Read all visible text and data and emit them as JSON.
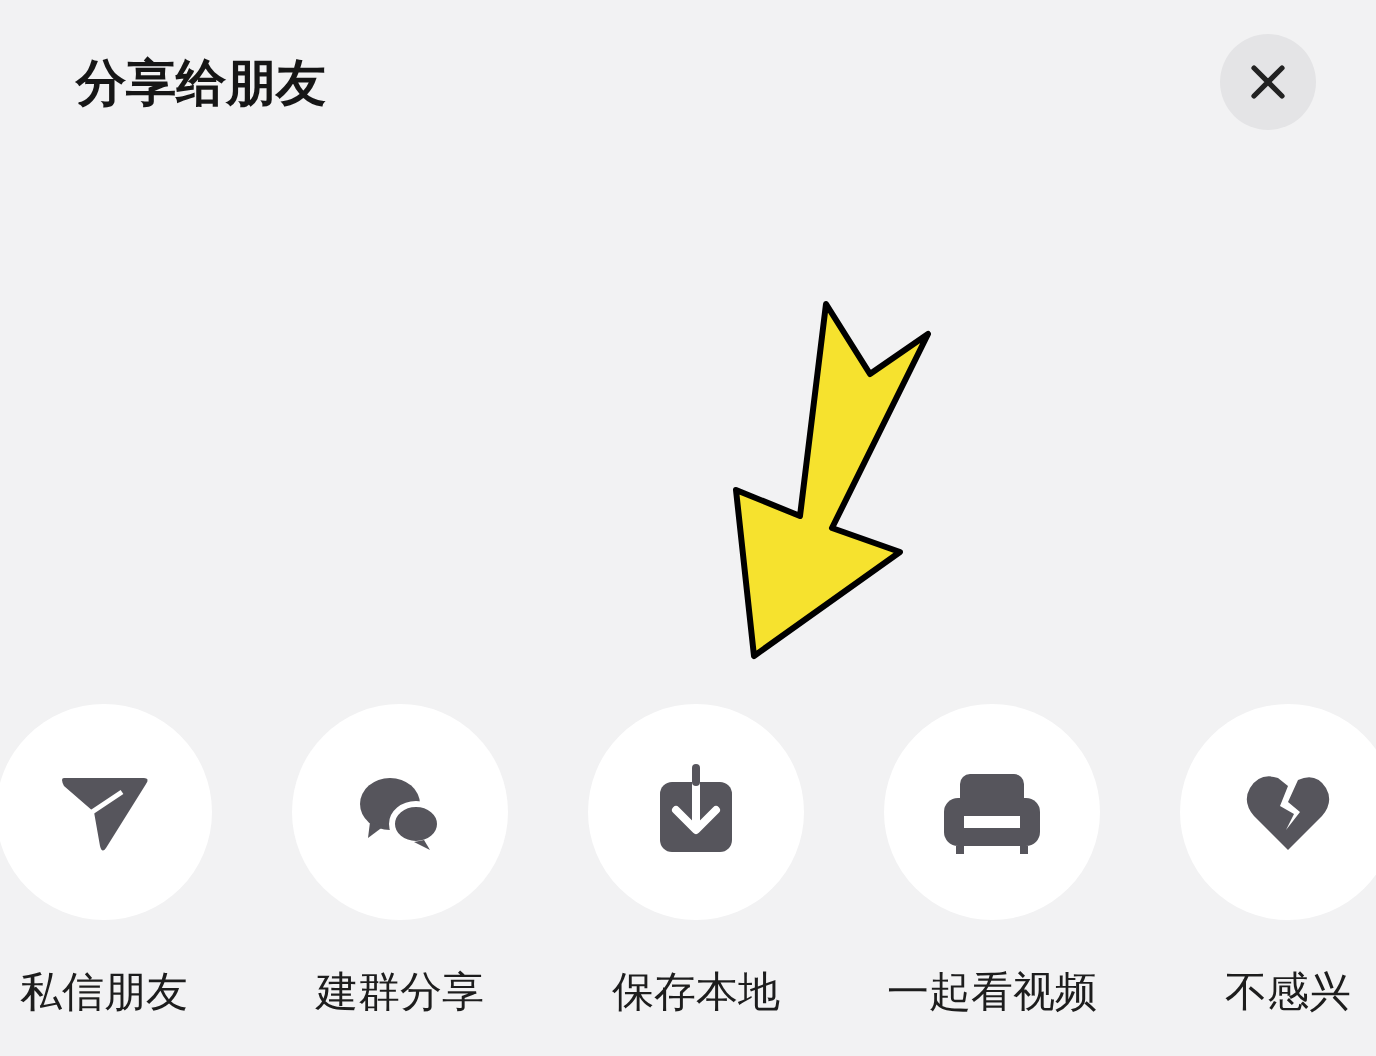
{
  "sheet": {
    "title": "分享给朋友"
  },
  "actions": [
    {
      "kind": "send",
      "label": "私信朋友"
    },
    {
      "kind": "group",
      "label": "建群分享"
    },
    {
      "kind": "save",
      "label": "保存本地"
    },
    {
      "kind": "watch",
      "label": "一起看视频"
    },
    {
      "kind": "dislike",
      "label": "不感兴"
    }
  ]
}
